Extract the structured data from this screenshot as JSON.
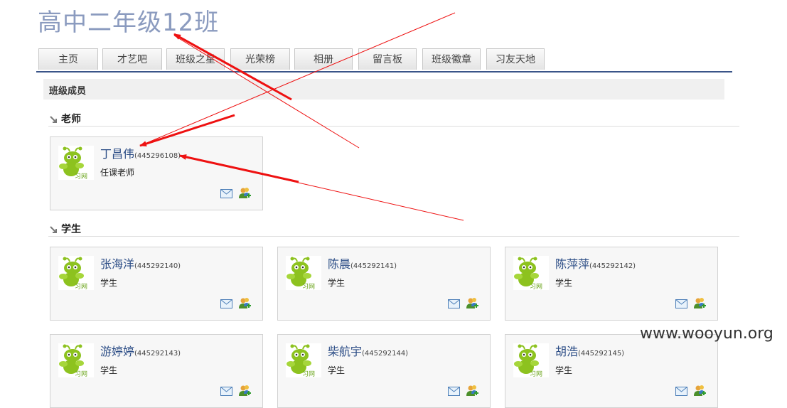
{
  "header": {
    "title": "高中二年级12班"
  },
  "nav": {
    "tabs": [
      "主页",
      "才艺吧",
      "班级之星",
      "光荣榜",
      "相册",
      "留言板",
      "班级徽章",
      "习友天地"
    ]
  },
  "members_section": {
    "title": "班级成员"
  },
  "groups": {
    "teachers": {
      "title": "老师",
      "members": [
        {
          "name": "丁昌伟",
          "id": "(445296108)",
          "role": "任课老师"
        }
      ]
    },
    "students": {
      "title": "学生",
      "members": [
        {
          "name": "张海洋",
          "id": "(445292140)",
          "role": "学生"
        },
        {
          "name": "陈晨",
          "id": "(445292141)",
          "role": "学生"
        },
        {
          "name": "陈萍萍",
          "id": "(445292142)",
          "role": "学生"
        },
        {
          "name": "游婷婷",
          "id": "(445292143)",
          "role": "学生"
        },
        {
          "name": "柴航宇",
          "id": "(445292144)",
          "role": "学生"
        },
        {
          "name": "胡浩",
          "id": "(445292145)",
          "role": "学生"
        }
      ]
    }
  },
  "avatar_logo_text": "习网",
  "watermark": "www.wooyun.org",
  "colors": {
    "accent": "#3a5488",
    "title": "#8b9bbf",
    "annotation": "#ee1111"
  }
}
